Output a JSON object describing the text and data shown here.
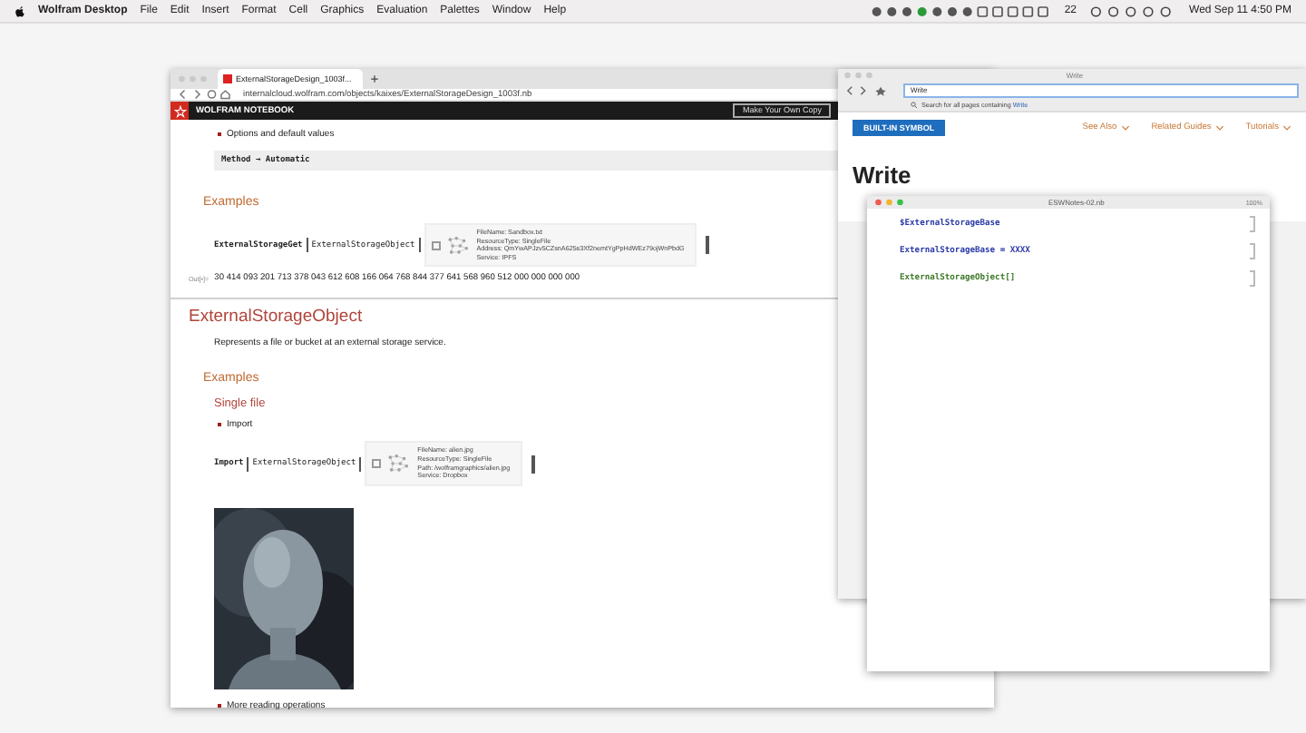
{
  "menu_bar": {
    "app": "Wolfram Desktop",
    "menus": [
      "File",
      "Edit",
      "Insert",
      "Format",
      "Cell",
      "Graphics",
      "Evaluation",
      "Palettes",
      "Window",
      "Help"
    ],
    "badge_count": "22",
    "clock": "Wed Sep 11  4:50 PM"
  },
  "left_browser": {
    "tab_title": "ExternalStorageDesign_1003f...",
    "url": "internalcloud.wolfram.com/objects/kaixes/ExternalStorageDesign_1003f.nb",
    "brand": "WOLFRAM NOTEBOOK",
    "copy_button": "Make Your Own Copy",
    "cells": [
      {
        "kind": "bullet",
        "text": "Options and default values"
      },
      {
        "kind": "code",
        "text": "Method → Automatic"
      },
      {
        "kind": "section",
        "text": "Examples"
      },
      {
        "kind": "input",
        "head": "ExternalStorageGet",
        "inner": "ExternalStorageObject",
        "summary": [
          "FileName: Sandbox.txt",
          "ResourceType: SingleFile",
          "Address: QmYwAPJzv5CZsnA625s3Xf2nemtYgPpHdWEz79ojWnPbdG",
          "Service: IPFS"
        ]
      },
      {
        "kind": "output",
        "label": "Out[•]=",
        "text": "30 414 093 201 713 378 043 612 608 166 064 768 844 377 641 568 960 512 000 000 000 000"
      },
      {
        "kind": "divider"
      },
      {
        "kind": "title",
        "text": "ExternalStorageObject"
      },
      {
        "kind": "text",
        "text": "Represents a file or bucket at an external storage service."
      },
      {
        "kind": "section",
        "text": "Examples"
      },
      {
        "kind": "subsection",
        "text": "Single file"
      },
      {
        "kind": "bullet",
        "text": "Import"
      },
      {
        "kind": "input",
        "head": "Import",
        "inner": "ExternalStorageObject",
        "summary": [
          "FileName: alien.jpg",
          "ResourceType: SingleFile",
          "Path: /wolframgraphics/alien.jpg",
          "Service: Dropbox"
        ]
      },
      {
        "kind": "picture"
      },
      {
        "kind": "bullet",
        "text": "More reading operations"
      }
    ]
  },
  "right_browser": {
    "tab_title": "Write",
    "search": "Write",
    "suggestion": "Search for all pages containing",
    "suggestion_link": "Write",
    "badge": "BUILT-IN SYMBOL",
    "links": [
      "See Also",
      "Related Guides",
      "Tutorials"
    ],
    "title": "Write"
  },
  "inner_window": {
    "title": "ESWNotes-02.nb",
    "zoom": "100%",
    "cells": [
      {
        "text": "$ExternalStorageBase",
        "color": "#2b3aa8"
      },
      {
        "text": "ExternalStorageBase = XXXX",
        "color": "#2b3aa8"
      },
      {
        "text": "ExternalStorageObject[]",
        "color": "#3f7a2a"
      }
    ]
  }
}
